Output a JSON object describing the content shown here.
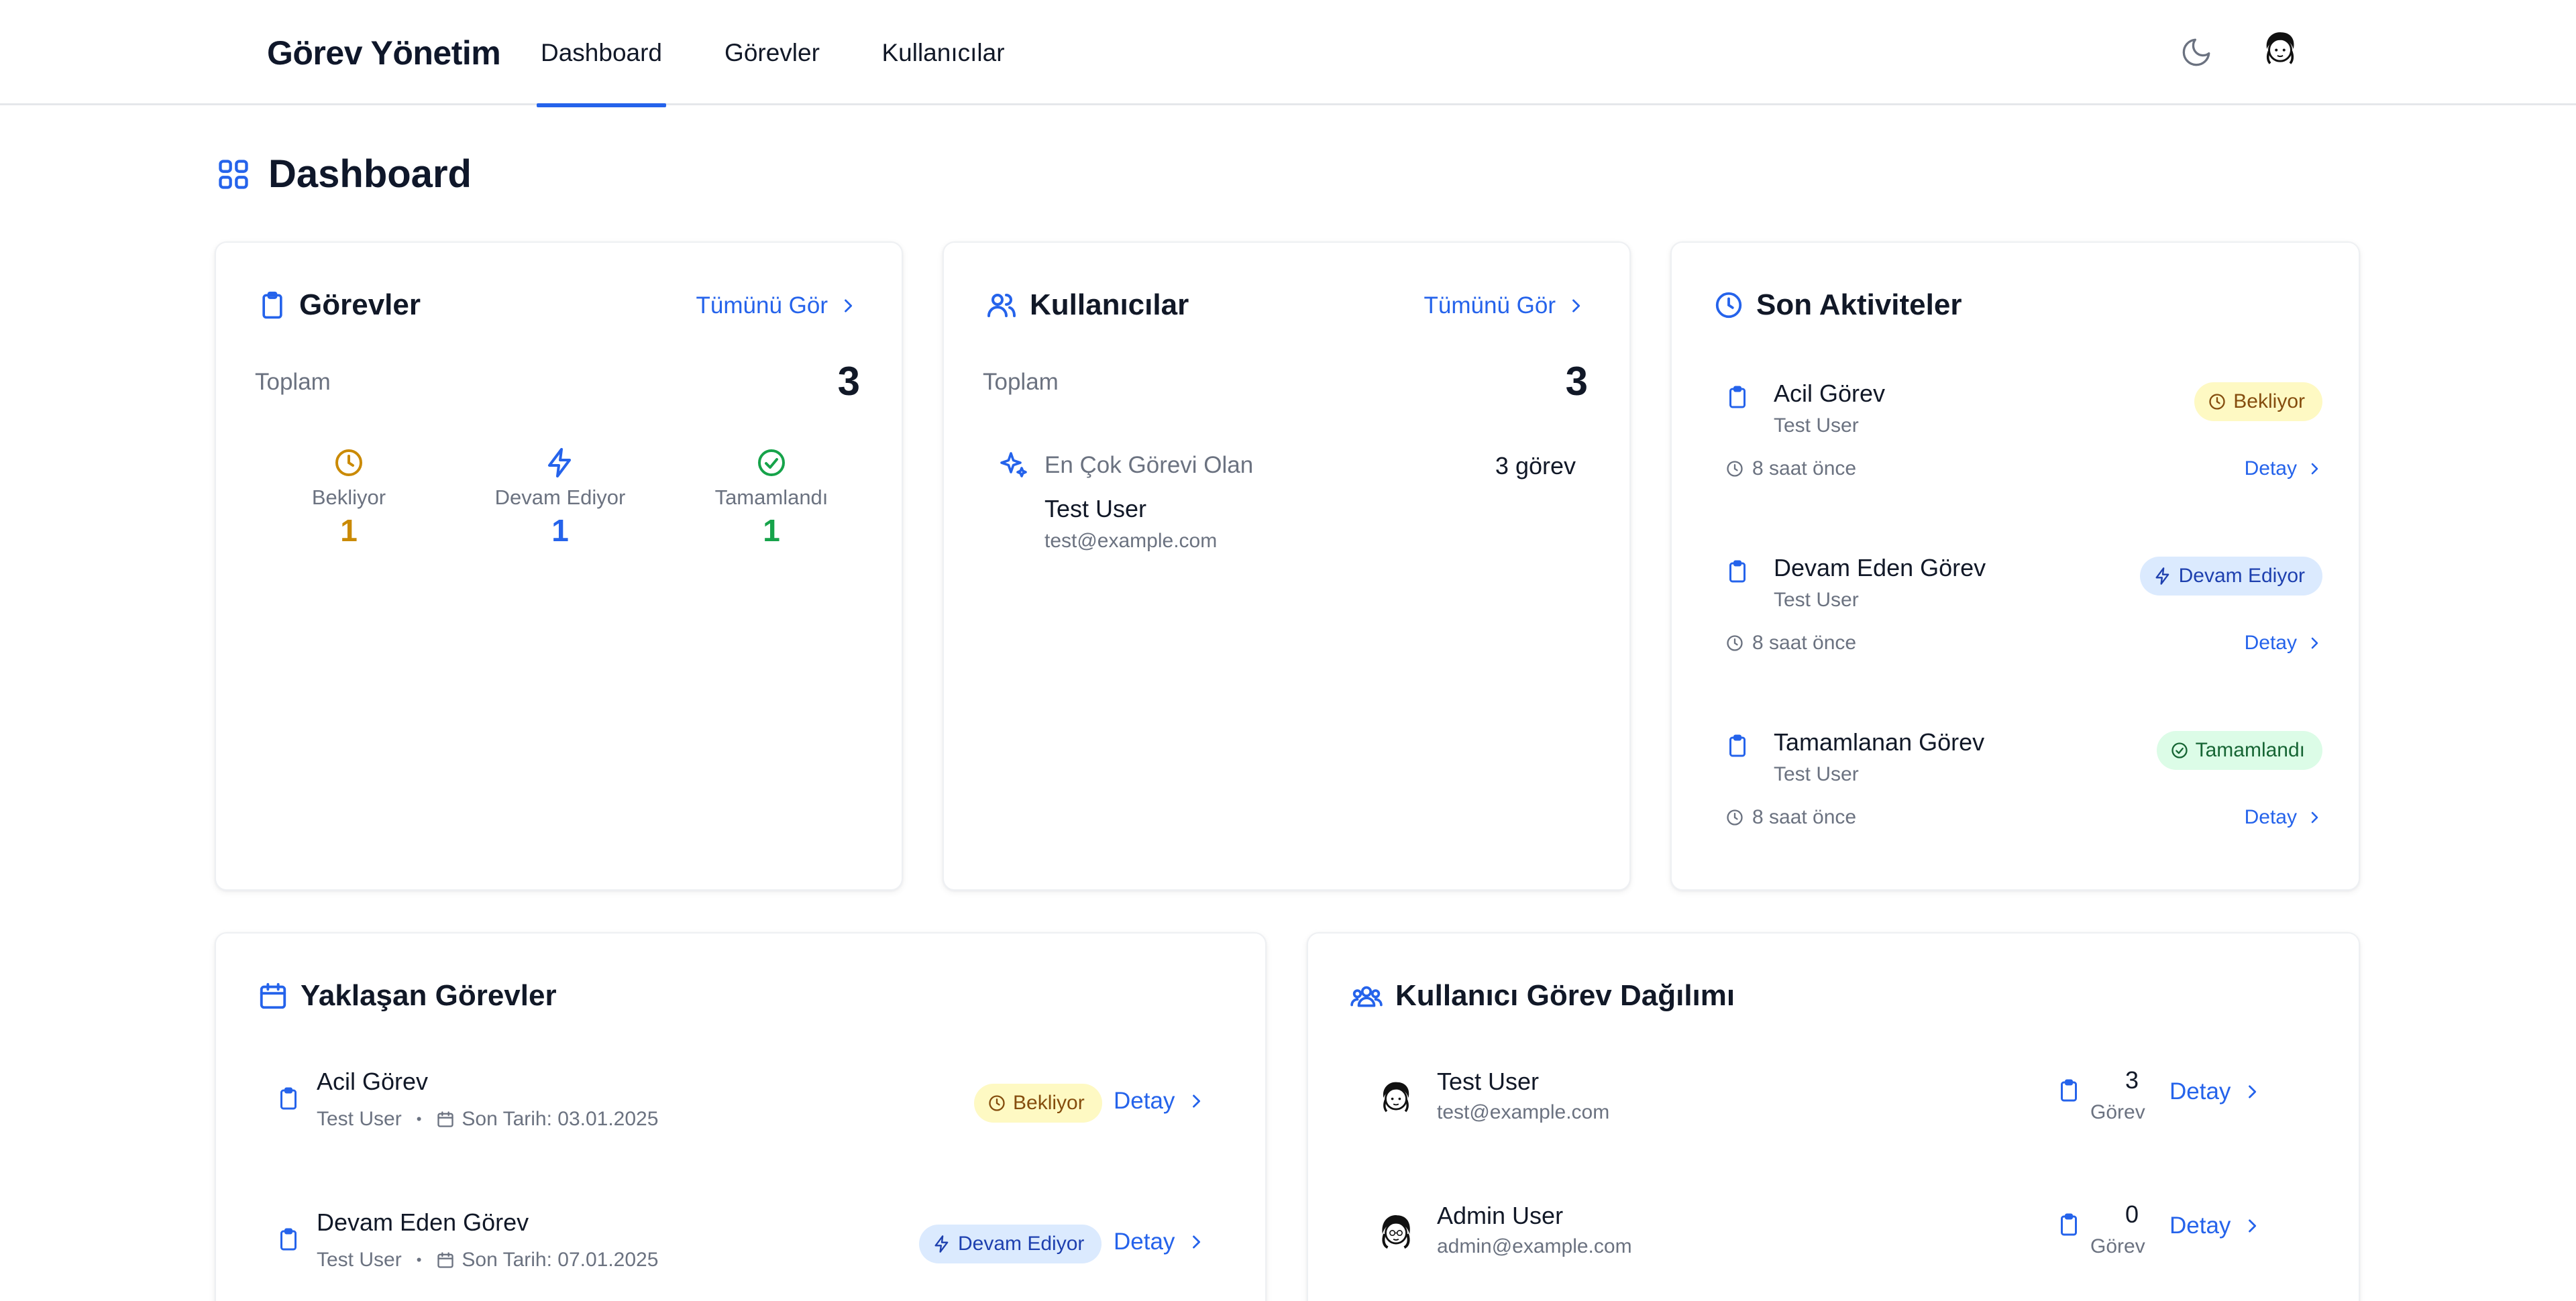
{
  "header": {
    "brand": "Görev Yönetim",
    "nav": [
      {
        "label": "Dashboard",
        "active": true
      },
      {
        "label": "Görevler",
        "active": false
      },
      {
        "label": "Kullanıcılar",
        "active": false
      }
    ],
    "icons": {
      "theme": "moon-icon",
      "avatar": "user-avatar"
    }
  },
  "page": {
    "title": "Dashboard",
    "icon": "grid-icon"
  },
  "tasks_card": {
    "title": "Görevler",
    "see_all": "Tümünü Gör",
    "total_label": "Toplam",
    "total": "3",
    "stats": [
      {
        "label": "Bekliyor",
        "value": "1",
        "color": "#ca8a04",
        "icon": "clock-icon"
      },
      {
        "label": "Devam Ediyor",
        "value": "1",
        "color": "#2563eb",
        "icon": "bolt-icon"
      },
      {
        "label": "Tamamlandı",
        "value": "1",
        "color": "#16a34a",
        "icon": "check-circle-icon"
      }
    ]
  },
  "users_card": {
    "title": "Kullanıcılar",
    "see_all": "Tümünü Gör",
    "total_label": "Toplam",
    "total": "3",
    "top_label": "En Çok Görevi Olan",
    "top_count": "3 görev",
    "top_name": "Test User",
    "top_email": "test@example.com"
  },
  "activities_card": {
    "title": "Son Aktiviteler",
    "items": [
      {
        "title": "Acil Görev",
        "user": "Test User",
        "time": "8 saat önce",
        "status": "Bekliyor",
        "status_type": "pending",
        "detail": "Detay"
      },
      {
        "title": "Devam Eden Görev",
        "user": "Test User",
        "time": "8 saat önce",
        "status": "Devam Ediyor",
        "status_type": "progress",
        "detail": "Detay"
      },
      {
        "title": "Tamamlanan Görev",
        "user": "Test User",
        "time": "8 saat önce",
        "status": "Tamamlandı",
        "status_type": "done",
        "detail": "Detay"
      }
    ]
  },
  "upcoming_card": {
    "title": "Yaklaşan Görevler",
    "items": [
      {
        "title": "Acil Görev",
        "user": "Test User",
        "sep": "•",
        "due": "Son Tarih: 03.01.2025",
        "status": "Bekliyor",
        "status_type": "pending",
        "detail": "Detay"
      },
      {
        "title": "Devam Eden Görev",
        "user": "Test User",
        "sep": "•",
        "due": "Son Tarih: 07.01.2025",
        "status": "Devam Ediyor",
        "status_type": "progress",
        "detail": "Detay"
      }
    ]
  },
  "distribution_card": {
    "title": "Kullanıcı Görev Dağılımı",
    "items": [
      {
        "name": "Test User",
        "email": "test@example.com",
        "count": "3",
        "count_label": "Görev",
        "detail": "Detay"
      },
      {
        "name": "Admin User",
        "email": "admin@example.com",
        "count": "0",
        "count_label": "Görev",
        "detail": "Detay"
      }
    ]
  },
  "colors": {
    "accent": "#2563eb",
    "pending": "#ca8a04",
    "progress": "#2563eb",
    "done": "#16a34a"
  }
}
